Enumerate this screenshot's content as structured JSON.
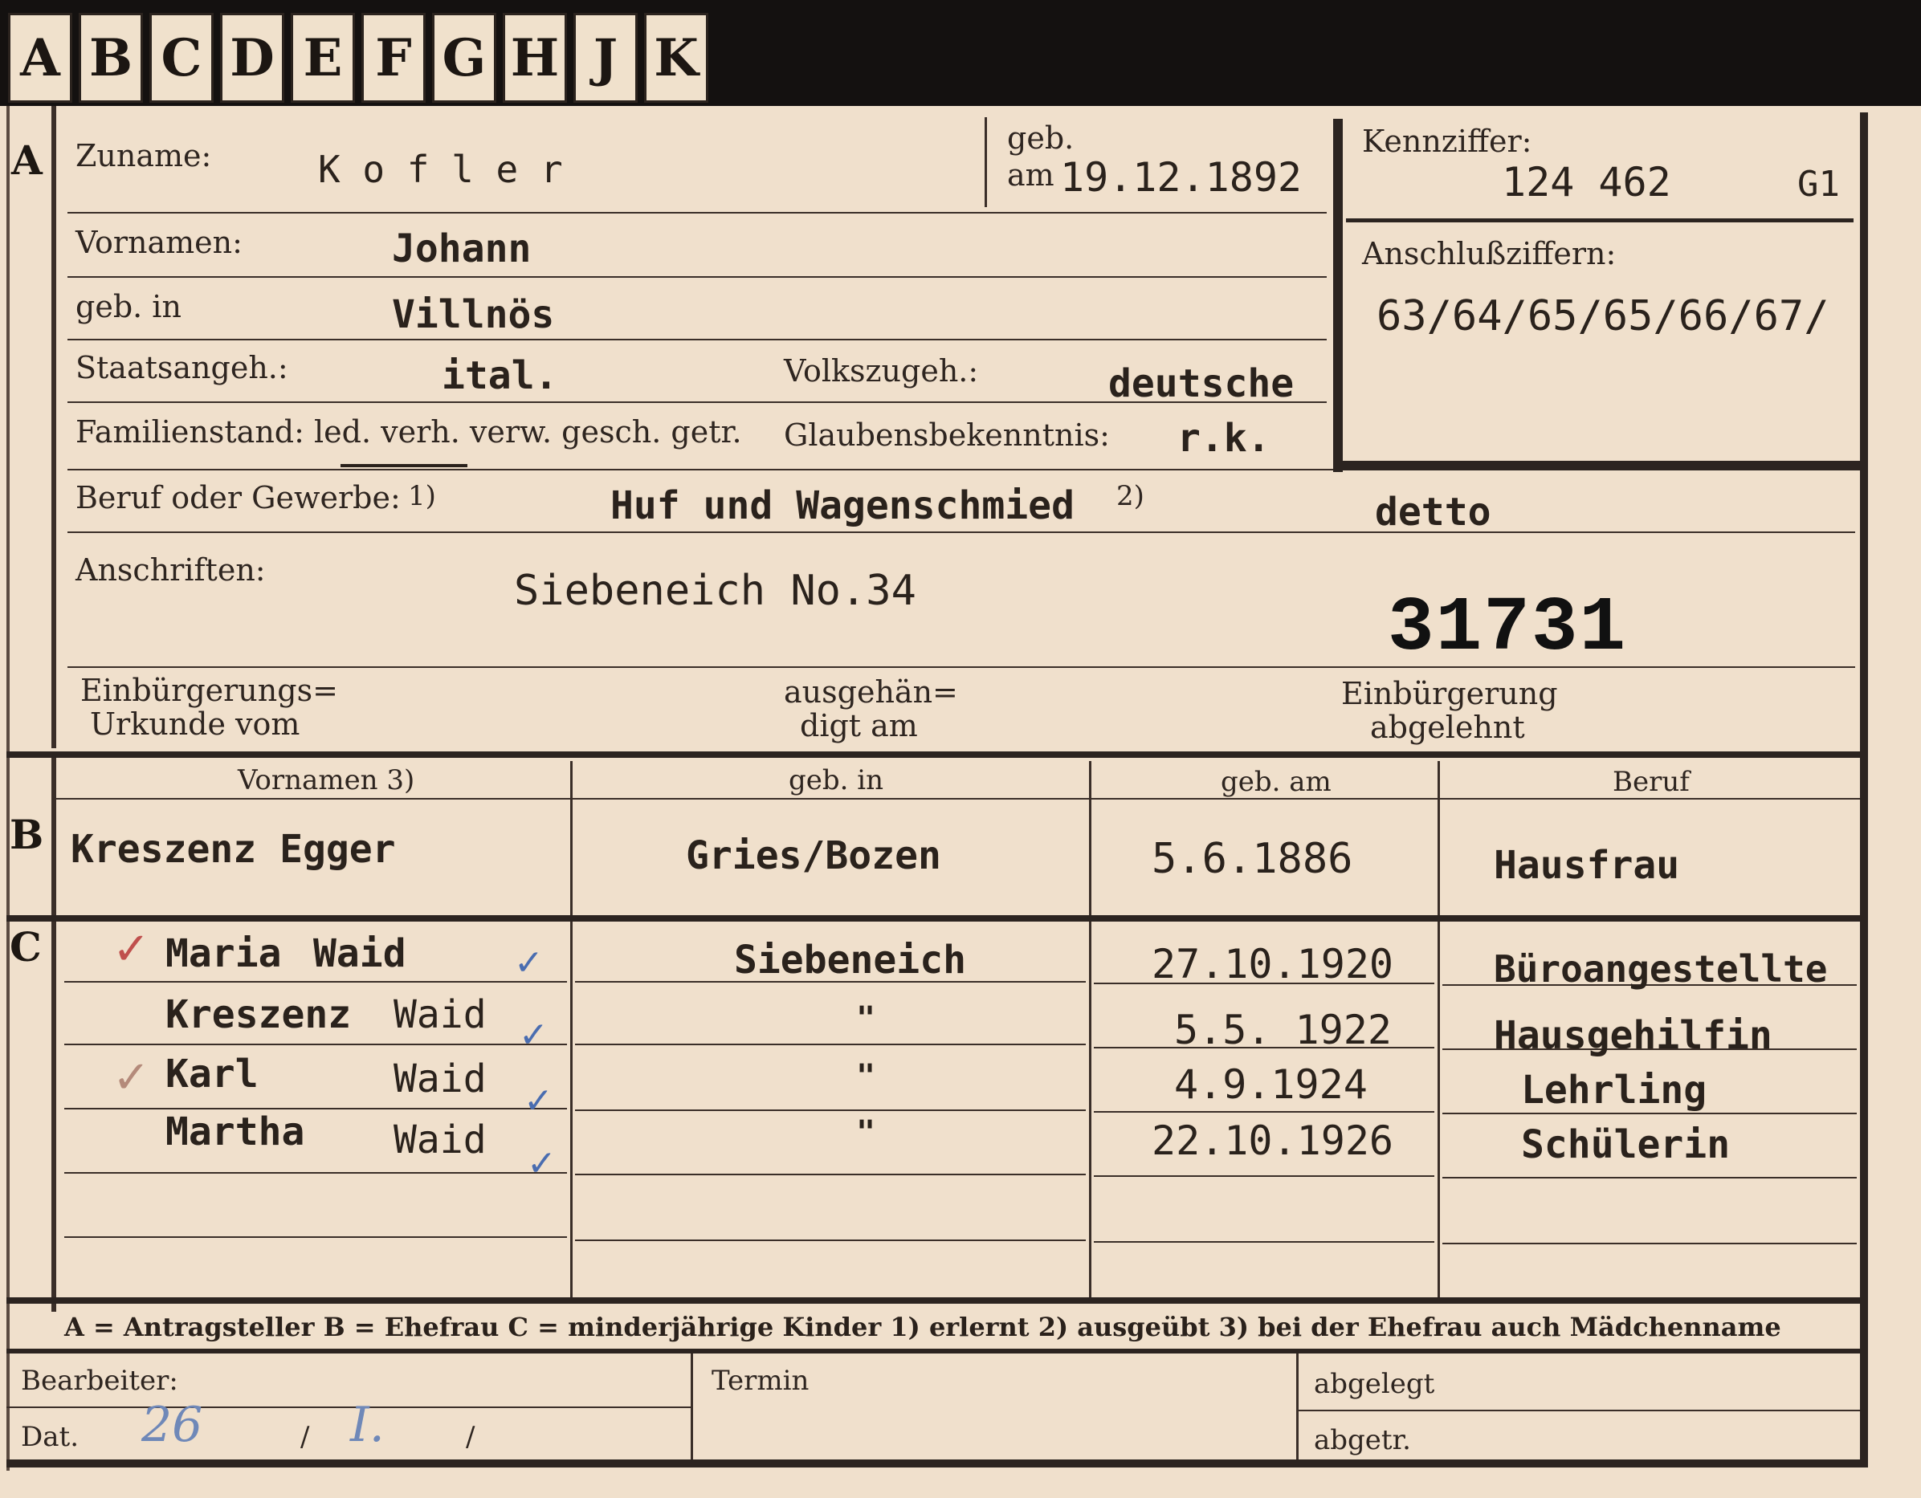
{
  "tabs": [
    "A",
    "B",
    "C",
    "D",
    "E",
    "F",
    "G",
    "H",
    "J",
    "K"
  ],
  "sections": {
    "a": "A",
    "b": "B",
    "c": "C"
  },
  "header": {
    "surname_label": "Zuname:",
    "surname": "K o f l e r",
    "born_label_1": "geb.",
    "born_label_2": "am",
    "born_date": "19.12.1892",
    "id_label": "Kennziffer:",
    "id_number": "124 462",
    "id_suffix": "G1",
    "annex_label": "Anschlußziffern:",
    "annex_numbers": "63/64/65/65/66/67/"
  },
  "person": {
    "firstnames_label": "Vornamen:",
    "firstnames": "Johann",
    "birthplace_label": "geb. in",
    "birthplace": "Villnös",
    "citizenship_label": "Staatsangeh.:",
    "citizenship": "ital.",
    "ethnicity_label": "Volkszugeh.:",
    "ethnicity": "deutsche",
    "family_label": "Familienstand: led. verh. verw. gesch. getr.",
    "religion_label": "Glaubensbekenntnis:",
    "religion": "r.k.",
    "profession_label": "Beruf oder Gewerbe:",
    "profession_mark_1": "1)",
    "profession": "Huf und Wagenschmied",
    "profession_mark_2": "2)",
    "profession_practiced": "detto",
    "address_label": "Anschriften:",
    "address": "Siebeneich No.34",
    "stamp_number": "31731",
    "naturalization_label_1": "Einbürgerungs=",
    "naturalization_label_2": "Urkunde vom",
    "handed_label_1": "ausgehän=",
    "handed_label_2": "digt am",
    "rejected_label_1": "Einbürgerung",
    "rejected_label_2": "abgelehnt"
  },
  "wife_table": {
    "headers": [
      "Vornamen 3)",
      "geb. in",
      "geb. am",
      "Beruf"
    ],
    "row": {
      "name": "Kreszenz Egger",
      "birthplace": "Gries/Bozen",
      "birthdate": "5.6.1886",
      "profession": "Hausfrau"
    }
  },
  "children": [
    {
      "firstname": "Maria",
      "surname": "Waid",
      "birthplace": "Siebeneich",
      "birthdate": "27.10.1920",
      "profession": "Büroangestellte"
    },
    {
      "firstname": "Kreszenz",
      "surname": "Waid",
      "birthplace": "\"",
      "birthdate": "5.5. 1922",
      "profession": "Hausgehilfin"
    },
    {
      "firstname": "Karl",
      "surname": "Waid",
      "birthplace": "\"",
      "birthdate": "4.9.1924",
      "profession": "Lehrling"
    },
    {
      "firstname": "Martha",
      "surname": "Waid",
      "birthplace": "\"",
      "birthdate": "22.10.1926",
      "profession": "Schülerin"
    }
  ],
  "check_mark": "✓",
  "legend": "A = Antragsteller   B = Ehefrau   C = minderjährige Kinder   1) erlernt   2) ausgeübt   3) bei der Ehefrau auch Mädchenname",
  "footer": {
    "processor_label": "Bearbeiter:",
    "date_label": "Dat.",
    "date_day": "26",
    "date_month": "I.",
    "date_sep": "/",
    "deadline_label": "Termin",
    "filed_label": "abgelegt",
    "removed_label": "abgetr."
  },
  "colors": {
    "paper": "#f0e0cc",
    "ink": "#2a211b",
    "check_blue": "#4a6db0",
    "check_red": "#c0504d"
  }
}
